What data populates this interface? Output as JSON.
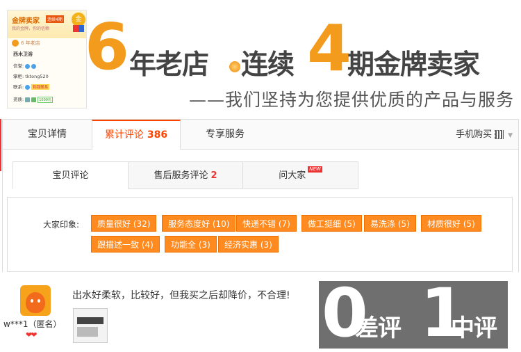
{
  "banner": {
    "store_card": {
      "gold_title": "金牌卖家",
      "gold_tag": "连续4期",
      "gold_sub": "我的金牌，你的信赖",
      "medal_char": "金",
      "years_badge": "6 年老店",
      "shop_name": "西木卫浴",
      "rows": [
        {
          "label": "信誉:",
          "value": ""
        },
        {
          "label": "掌柜:",
          "value": "tktong520"
        },
        {
          "label": "联系:",
          "value": "和我联系"
        },
        {
          "label": "资质:",
          "value": "1000元"
        }
      ]
    },
    "big_six": "6",
    "slogan_a": "年老店",
    "slogan_b": "连续",
    "big_four": "4",
    "slogan_c": "期金牌卖家",
    "tagline": "——我们坚持为您提供优质的产品与服务"
  },
  "tabs": {
    "detail": "宝贝详情",
    "reviews": "累计评论",
    "reviews_count": "386",
    "service": "专享服务",
    "mobile_buy": "手机购买"
  },
  "subtabs": {
    "review": "宝贝评论",
    "after_sale": "售后服务评论",
    "after_sale_count": "2",
    "ask": "问大家",
    "new_badge": "NEW"
  },
  "impressions": {
    "label": "大家印象:",
    "tags": [
      "质量很好 (32)",
      "服务态度好 (10)",
      "快递不错 (7)",
      "做工挺细 (5)",
      "易洗涤 (5)",
      "材质很好 (5)",
      "跟描述一致 (4)",
      "功能全 (3)",
      "经济实惠 (3)"
    ]
  },
  "review": {
    "user_name": "w***1（匿名）",
    "hearts": "❤❤",
    "text": "出水好柔软，比较好，但我买之后却降价，不合理!"
  },
  "stats": {
    "bad_count": "0",
    "bad_label": "差评",
    "mid_count": "1",
    "mid_label": "中评"
  },
  "colors": {
    "accent": "#ff4400",
    "tag_bg": "#ff8a1f",
    "banner_orange": "#f29b1d",
    "stats_bg": "#6f6f6f"
  }
}
